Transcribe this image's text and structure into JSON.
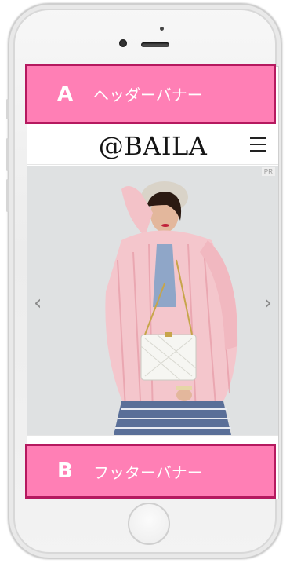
{
  "header_banner": {
    "letter": "A",
    "label": "ヘッダーバナー"
  },
  "site": {
    "logo": "@BAILA",
    "badge": "PR"
  },
  "carousel": {
    "prev": "‹",
    "next": "›"
  },
  "footer_banner": {
    "letter": "B",
    "label": "フッターバナー"
  },
  "colors": {
    "banner_fill": "#ff7fb5",
    "banner_border": "#b5195f"
  },
  "icons": [
    "menu-icon",
    "chevron-left-icon",
    "chevron-right-icon",
    "home-button-icon",
    "speaker-icon",
    "front-camera-icon"
  ]
}
